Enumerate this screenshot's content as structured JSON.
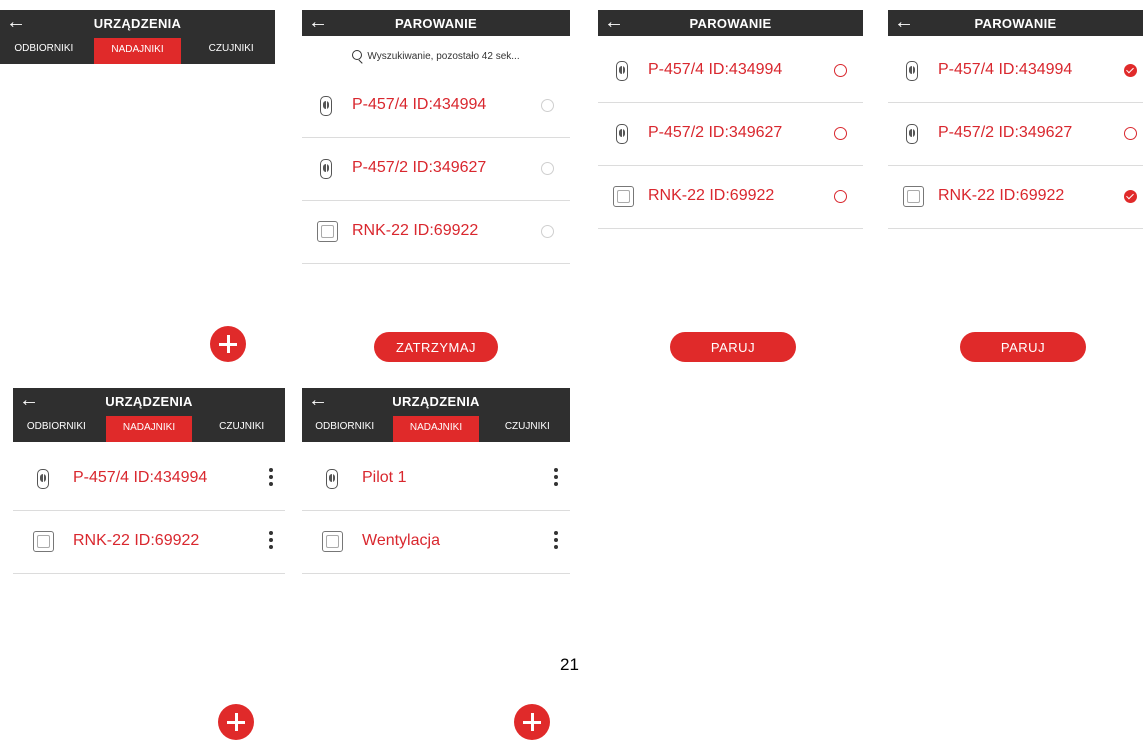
{
  "colors": {
    "accent": "#e02a2a",
    "header": "#2f2f2f",
    "text_red": "#d9272e"
  },
  "screen1": {
    "back_icon": "back-arrow-icon",
    "title": "URZĄDZENIA",
    "tabs": [
      "ODBIORNIKI",
      "NADAJNIKI",
      "CZUJNIKI"
    ],
    "active_tab": "NADAJNIKI"
  },
  "screen2": {
    "title": "PAROWANIE",
    "search_text": "Wyszukiwanie, pozostało 42 sek...",
    "items": [
      {
        "label": "P-457/4 ID:434994",
        "icon": "remote-icon",
        "selected": false
      },
      {
        "label": "P-457/2 ID:349627",
        "icon": "remote-icon",
        "selected": false
      },
      {
        "label": "RNK-22 ID:69922",
        "icon": "sensor-icon",
        "selected": false
      }
    ],
    "button": "ZATRZYMAJ"
  },
  "screen3": {
    "title": "PAROWANIE",
    "items": [
      {
        "label": "P-457/4 ID:434994",
        "selected": false
      },
      {
        "label": "P-457/2 ID:349627",
        "selected": false
      },
      {
        "label": "RNK-22 ID:69922",
        "selected": false
      }
    ],
    "button": "PARUJ"
  },
  "screen4": {
    "title": "PAROWANIE",
    "items": [
      {
        "label": "P-457/4 ID:434994",
        "selected": true
      },
      {
        "label": "P-457/2 ID:349627",
        "selected": false
      },
      {
        "label": "RNK-22 ID:69922",
        "selected": true
      }
    ],
    "button": "PARUJ"
  },
  "screen5": {
    "title": "URZĄDZENIA",
    "tabs": [
      "ODBIORNIKI",
      "NADAJNIKI",
      "CZUJNIKI"
    ],
    "items": [
      {
        "label": "P-457/4 ID:434994"
      },
      {
        "label": "RNK-22 ID:69922"
      }
    ]
  },
  "screen6": {
    "title": "URZĄDZENIA",
    "tabs": [
      "ODBIORNIKI",
      "NADAJNIKI",
      "CZUJNIKI"
    ],
    "items": [
      {
        "label": "Pilot 1"
      },
      {
        "label": "Wentylacja"
      }
    ]
  },
  "page_number": "21"
}
